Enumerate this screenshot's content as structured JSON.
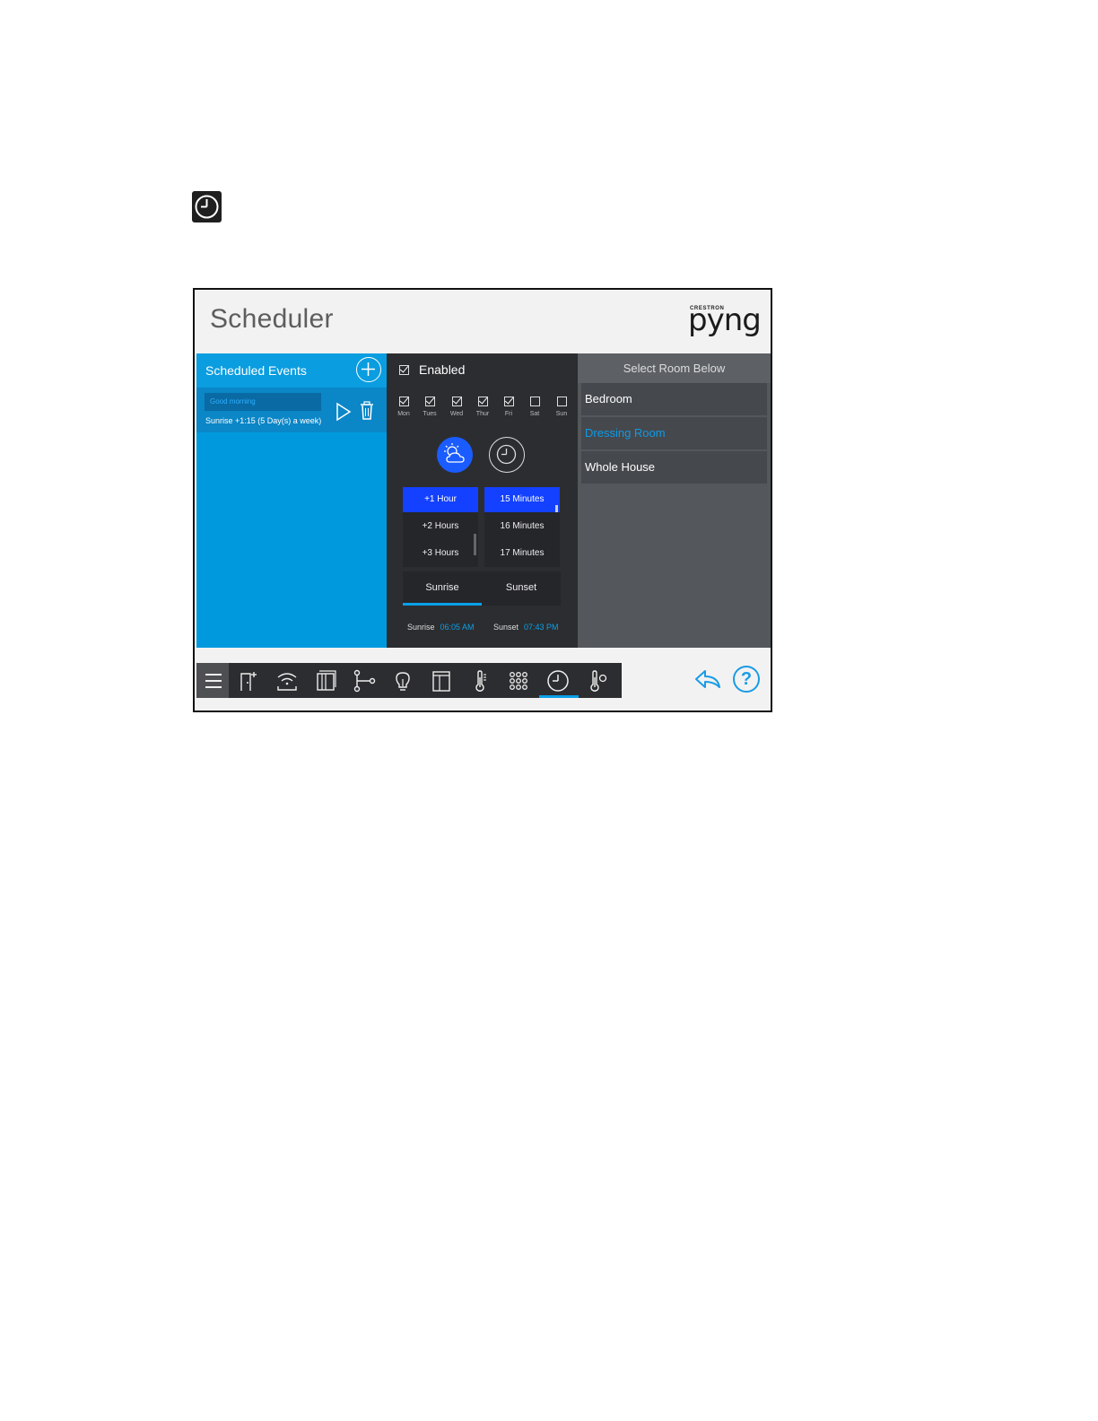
{
  "app": {
    "title": "Scheduler",
    "logo_small": "CRESTRON",
    "logo_main": "pyng"
  },
  "scheduled_events": {
    "header": "Scheduled Events",
    "events": [
      {
        "name": "Good morning",
        "description": "Sunrise +1:15 (5 Day(s) a week)"
      }
    ]
  },
  "editor": {
    "enabled_label": "Enabled",
    "enabled": true,
    "days": [
      {
        "label": "Mon",
        "checked": true
      },
      {
        "label": "Tues",
        "checked": true
      },
      {
        "label": "Wed",
        "checked": true
      },
      {
        "label": "Thur",
        "checked": true
      },
      {
        "label": "Fri",
        "checked": true
      },
      {
        "label": "Sat",
        "checked": false
      },
      {
        "label": "Sun",
        "checked": false
      }
    ],
    "hours": [
      {
        "label": "+1 Hour",
        "selected": true
      },
      {
        "label": "+2 Hours",
        "selected": false
      },
      {
        "label": "+3 Hours",
        "selected": false
      }
    ],
    "minutes": [
      {
        "label": "15 Minutes",
        "selected": true
      },
      {
        "label": "16 Minutes",
        "selected": false
      },
      {
        "label": "17 Minutes",
        "selected": false
      }
    ],
    "tabs": [
      {
        "label": "Sunrise",
        "active": true
      },
      {
        "label": "Sunset",
        "active": false
      }
    ],
    "sunrise_label": "Sunrise",
    "sunrise_time": "06:05 AM",
    "sunset_label": "Sunset",
    "sunset_time": "07:43 PM"
  },
  "rooms": {
    "header": "Select Room Below",
    "items": [
      {
        "label": "Bedroom",
        "active": false
      },
      {
        "label": "Dressing Room",
        "active": true
      },
      {
        "label": "Whole House",
        "active": false
      }
    ]
  },
  "colors": {
    "accent_blue": "#0099dd",
    "selected_blue": "#1341ff",
    "highlight_text": "#0d9be6"
  },
  "toolbar": {
    "icons": [
      "menu-icon",
      "room-add-icon",
      "wireless-icon",
      "shades-icon",
      "network-icon",
      "light-bulb-icon",
      "window-icon",
      "thermostat-icon",
      "keypad-icon",
      "clock-icon",
      "temperature-icon"
    ],
    "active_icon": "clock-icon"
  }
}
